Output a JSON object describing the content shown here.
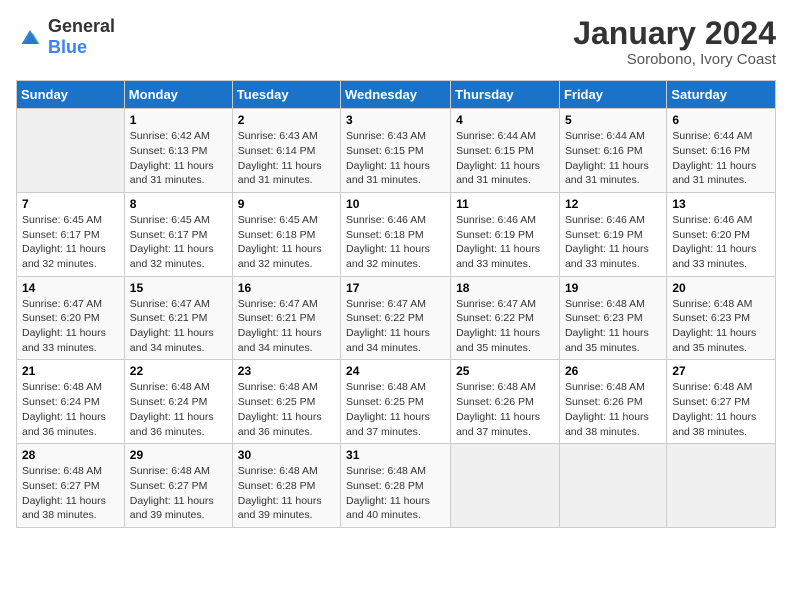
{
  "header": {
    "logo_general": "General",
    "logo_blue": "Blue",
    "title": "January 2024",
    "subtitle": "Sorobono, Ivory Coast"
  },
  "days_of_week": [
    "Sunday",
    "Monday",
    "Tuesday",
    "Wednesday",
    "Thursday",
    "Friday",
    "Saturday"
  ],
  "weeks": [
    [
      {
        "day": "",
        "empty": true
      },
      {
        "day": "1",
        "sunrise": "Sunrise: 6:42 AM",
        "sunset": "Sunset: 6:13 PM",
        "daylight": "Daylight: 11 hours and 31 minutes."
      },
      {
        "day": "2",
        "sunrise": "Sunrise: 6:43 AM",
        "sunset": "Sunset: 6:14 PM",
        "daylight": "Daylight: 11 hours and 31 minutes."
      },
      {
        "day": "3",
        "sunrise": "Sunrise: 6:43 AM",
        "sunset": "Sunset: 6:15 PM",
        "daylight": "Daylight: 11 hours and 31 minutes."
      },
      {
        "day": "4",
        "sunrise": "Sunrise: 6:44 AM",
        "sunset": "Sunset: 6:15 PM",
        "daylight": "Daylight: 11 hours and 31 minutes."
      },
      {
        "day": "5",
        "sunrise": "Sunrise: 6:44 AM",
        "sunset": "Sunset: 6:16 PM",
        "daylight": "Daylight: 11 hours and 31 minutes."
      },
      {
        "day": "6",
        "sunrise": "Sunrise: 6:44 AM",
        "sunset": "Sunset: 6:16 PM",
        "daylight": "Daylight: 11 hours and 31 minutes."
      }
    ],
    [
      {
        "day": "7",
        "sunrise": "Sunrise: 6:45 AM",
        "sunset": "Sunset: 6:17 PM",
        "daylight": "Daylight: 11 hours and 32 minutes."
      },
      {
        "day": "8",
        "sunrise": "Sunrise: 6:45 AM",
        "sunset": "Sunset: 6:17 PM",
        "daylight": "Daylight: 11 hours and 32 minutes."
      },
      {
        "day": "9",
        "sunrise": "Sunrise: 6:45 AM",
        "sunset": "Sunset: 6:18 PM",
        "daylight": "Daylight: 11 hours and 32 minutes."
      },
      {
        "day": "10",
        "sunrise": "Sunrise: 6:46 AM",
        "sunset": "Sunset: 6:18 PM",
        "daylight": "Daylight: 11 hours and 32 minutes."
      },
      {
        "day": "11",
        "sunrise": "Sunrise: 6:46 AM",
        "sunset": "Sunset: 6:19 PM",
        "daylight": "Daylight: 11 hours and 33 minutes."
      },
      {
        "day": "12",
        "sunrise": "Sunrise: 6:46 AM",
        "sunset": "Sunset: 6:19 PM",
        "daylight": "Daylight: 11 hours and 33 minutes."
      },
      {
        "day": "13",
        "sunrise": "Sunrise: 6:46 AM",
        "sunset": "Sunset: 6:20 PM",
        "daylight": "Daylight: 11 hours and 33 minutes."
      }
    ],
    [
      {
        "day": "14",
        "sunrise": "Sunrise: 6:47 AM",
        "sunset": "Sunset: 6:20 PM",
        "daylight": "Daylight: 11 hours and 33 minutes."
      },
      {
        "day": "15",
        "sunrise": "Sunrise: 6:47 AM",
        "sunset": "Sunset: 6:21 PM",
        "daylight": "Daylight: 11 hours and 34 minutes."
      },
      {
        "day": "16",
        "sunrise": "Sunrise: 6:47 AM",
        "sunset": "Sunset: 6:21 PM",
        "daylight": "Daylight: 11 hours and 34 minutes."
      },
      {
        "day": "17",
        "sunrise": "Sunrise: 6:47 AM",
        "sunset": "Sunset: 6:22 PM",
        "daylight": "Daylight: 11 hours and 34 minutes."
      },
      {
        "day": "18",
        "sunrise": "Sunrise: 6:47 AM",
        "sunset": "Sunset: 6:22 PM",
        "daylight": "Daylight: 11 hours and 35 minutes."
      },
      {
        "day": "19",
        "sunrise": "Sunrise: 6:48 AM",
        "sunset": "Sunset: 6:23 PM",
        "daylight": "Daylight: 11 hours and 35 minutes."
      },
      {
        "day": "20",
        "sunrise": "Sunrise: 6:48 AM",
        "sunset": "Sunset: 6:23 PM",
        "daylight": "Daylight: 11 hours and 35 minutes."
      }
    ],
    [
      {
        "day": "21",
        "sunrise": "Sunrise: 6:48 AM",
        "sunset": "Sunset: 6:24 PM",
        "daylight": "Daylight: 11 hours and 36 minutes."
      },
      {
        "day": "22",
        "sunrise": "Sunrise: 6:48 AM",
        "sunset": "Sunset: 6:24 PM",
        "daylight": "Daylight: 11 hours and 36 minutes."
      },
      {
        "day": "23",
        "sunrise": "Sunrise: 6:48 AM",
        "sunset": "Sunset: 6:25 PM",
        "daylight": "Daylight: 11 hours and 36 minutes."
      },
      {
        "day": "24",
        "sunrise": "Sunrise: 6:48 AM",
        "sunset": "Sunset: 6:25 PM",
        "daylight": "Daylight: 11 hours and 37 minutes."
      },
      {
        "day": "25",
        "sunrise": "Sunrise: 6:48 AM",
        "sunset": "Sunset: 6:26 PM",
        "daylight": "Daylight: 11 hours and 37 minutes."
      },
      {
        "day": "26",
        "sunrise": "Sunrise: 6:48 AM",
        "sunset": "Sunset: 6:26 PM",
        "daylight": "Daylight: 11 hours and 38 minutes."
      },
      {
        "day": "27",
        "sunrise": "Sunrise: 6:48 AM",
        "sunset": "Sunset: 6:27 PM",
        "daylight": "Daylight: 11 hours and 38 minutes."
      }
    ],
    [
      {
        "day": "28",
        "sunrise": "Sunrise: 6:48 AM",
        "sunset": "Sunset: 6:27 PM",
        "daylight": "Daylight: 11 hours and 38 minutes."
      },
      {
        "day": "29",
        "sunrise": "Sunrise: 6:48 AM",
        "sunset": "Sunset: 6:27 PM",
        "daylight": "Daylight: 11 hours and 39 minutes."
      },
      {
        "day": "30",
        "sunrise": "Sunrise: 6:48 AM",
        "sunset": "Sunset: 6:28 PM",
        "daylight": "Daylight: 11 hours and 39 minutes."
      },
      {
        "day": "31",
        "sunrise": "Sunrise: 6:48 AM",
        "sunset": "Sunset: 6:28 PM",
        "daylight": "Daylight: 11 hours and 40 minutes."
      },
      {
        "day": "",
        "empty": true
      },
      {
        "day": "",
        "empty": true
      },
      {
        "day": "",
        "empty": true
      }
    ]
  ]
}
